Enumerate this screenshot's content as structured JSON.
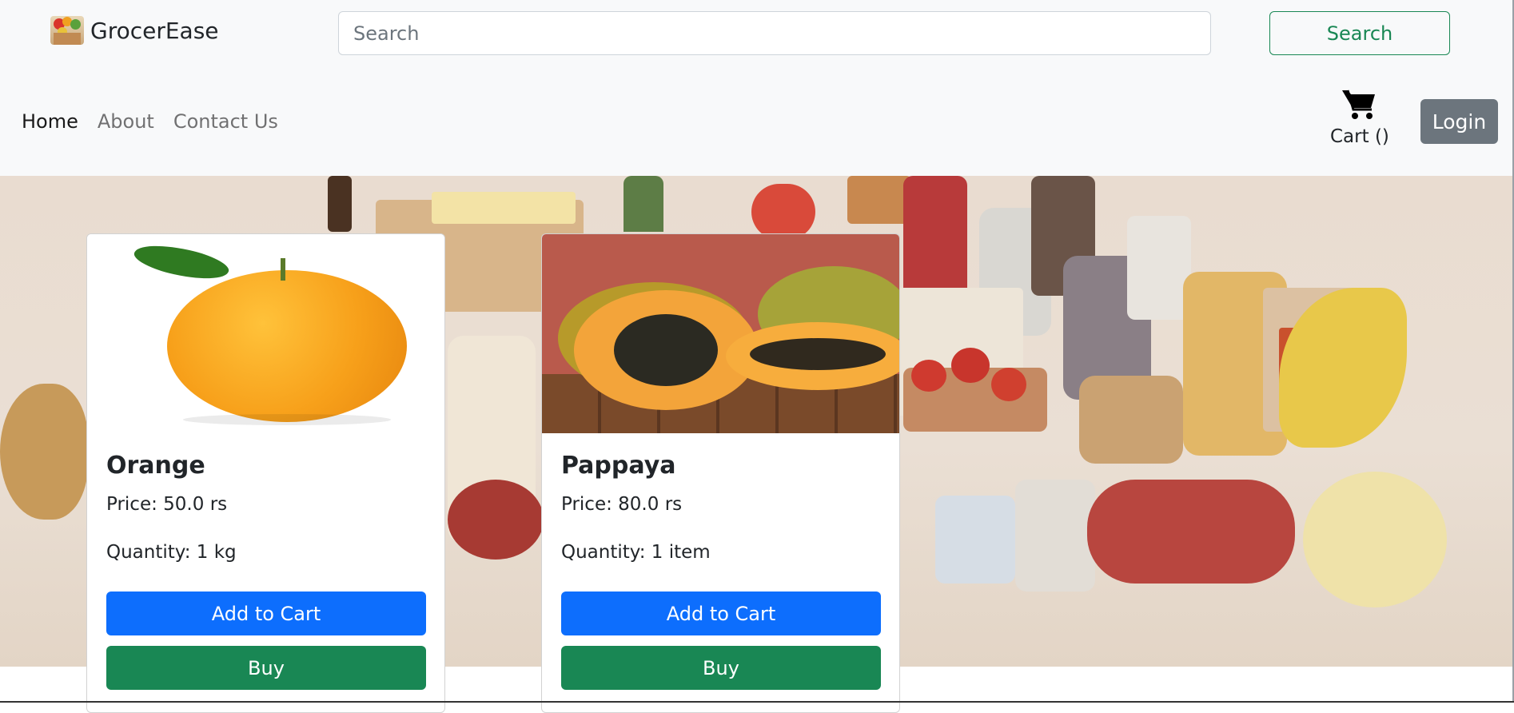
{
  "brand": {
    "name": "GrocerEase",
    "logo_icon": "grocery-basket-icon"
  },
  "search": {
    "placeholder": "Search",
    "value": "",
    "button_label": "Search"
  },
  "nav": {
    "links": [
      {
        "label": "Home",
        "active": true
      },
      {
        "label": "About",
        "active": false
      },
      {
        "label": "Contact Us",
        "active": false
      }
    ]
  },
  "cart": {
    "icon": "shopping-cart-icon",
    "label": "Cart ()"
  },
  "auth": {
    "login_label": "Login"
  },
  "colors": {
    "primary": "#0d6efd",
    "success": "#198754",
    "secondary": "#6c757d",
    "navbar_bg": "#f8f9fa"
  },
  "products": [
    {
      "name": "Orange",
      "price": "Price: 50.0 rs",
      "quantity": "Quantity: 1 kg",
      "add_to_cart_label": "Add to Cart",
      "buy_label": "Buy"
    },
    {
      "name": "Pappaya",
      "price": "Price: 80.0 rs",
      "quantity": "Quantity: 1 item",
      "add_to_cart_label": "Add to Cart",
      "buy_label": "Buy"
    }
  ]
}
